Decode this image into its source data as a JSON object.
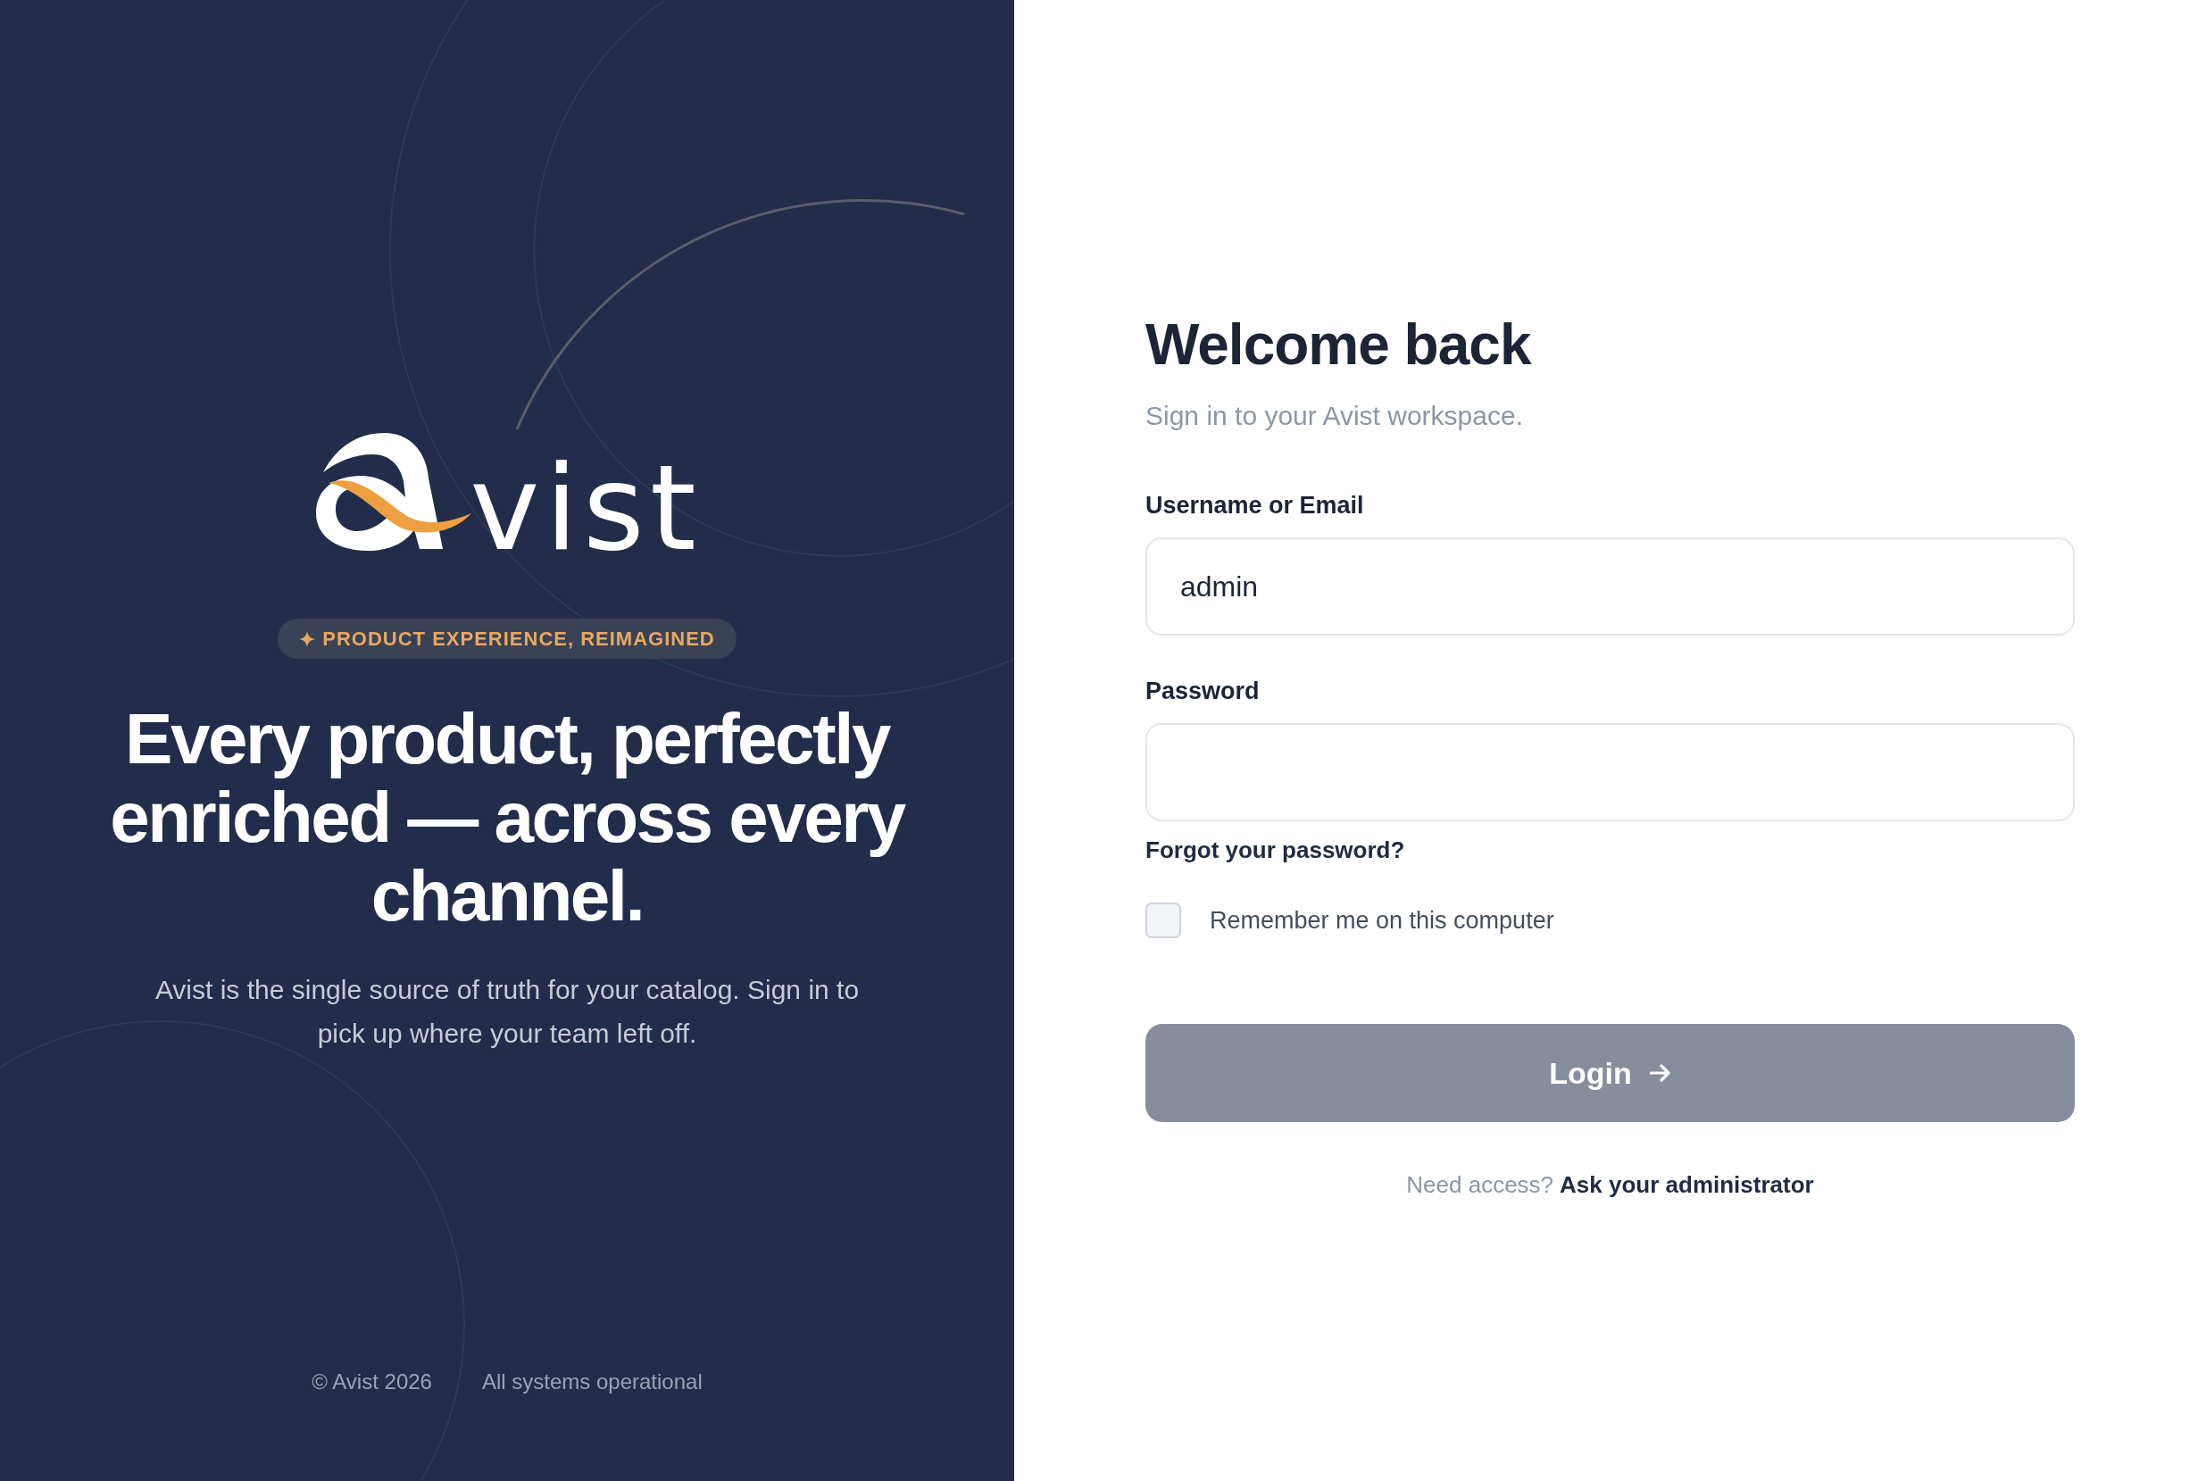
{
  "brand_panel": {
    "logo": {
      "wordmark": "vist"
    },
    "badge": "PRODUCT EXPERIENCE, REIMAGINED",
    "headline": "Every product, perfectly enriched — across every channel.",
    "description": "Avist is the single source of truth for your catalog. Sign in to pick up where your team left off.",
    "footer": [
      "© Avist 2026",
      "All systems operational"
    ]
  },
  "login_form": {
    "title": "Welcome back",
    "subtitle": "Sign in to your Avist workspace.",
    "fields": [
      {
        "label": "Username or Email",
        "value": "admin"
      },
      {
        "label": "Password"
      }
    ],
    "forgot_link": "Forgot your password?",
    "remember": {
      "label": "Remember me on this computer",
      "checked": false
    },
    "submit": {
      "label": "Login",
      "disabled": true
    },
    "access_note": {
      "prompt": "Need access?",
      "link": "Ask your administrator"
    }
  }
}
